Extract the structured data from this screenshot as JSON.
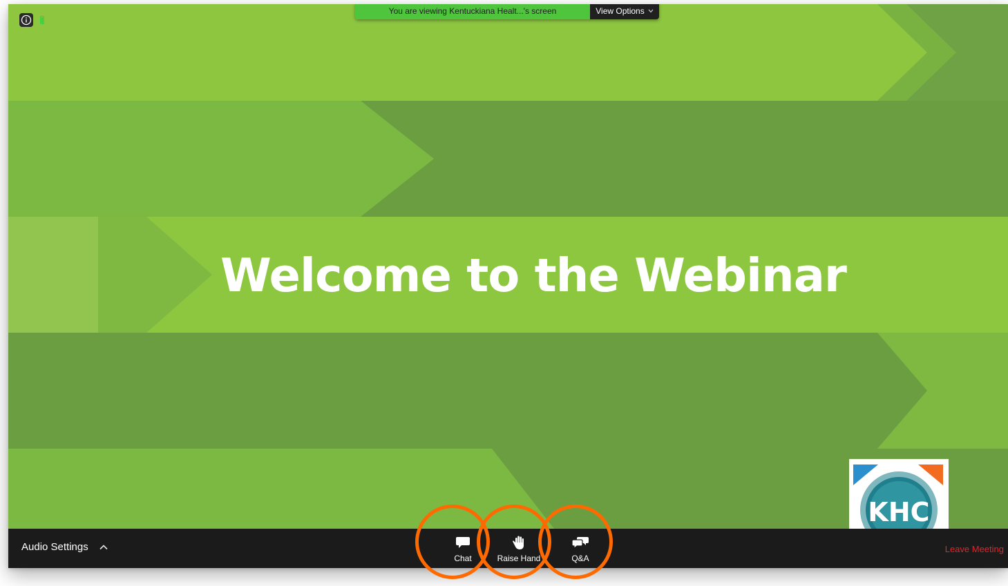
{
  "share_banner": {
    "message": "You are viewing Kentuckiana Healt...'s screen",
    "view_options_label": "View Options"
  },
  "slide": {
    "title": "Welcome to the Webinar",
    "logo_text": "KHC"
  },
  "toolbar": {
    "audio_settings_label": "Audio Settings",
    "chat_label": "Chat",
    "raise_hand_label": "Raise Hand",
    "qa_label": "Q&A",
    "leave_label": "Leave Meeting"
  },
  "colors": {
    "slide_green_light": "#8dc63f",
    "slide_green_mid": "#7cb942",
    "slide_green_dark": "#6b9e41",
    "toolbar_bg": "#1b1b1b",
    "banner_green": "#4fc43d",
    "leave_red": "#e0242b",
    "highlight_orange": "#ff6a00"
  },
  "icons": {
    "info": "info-icon",
    "connection": "battery-icon",
    "view_options": "chevron-down-icon",
    "audio_settings": "chevron-up-icon",
    "chat": "chat-bubble-icon",
    "raise_hand": "hand-icon",
    "qa": "qa-bubbles-icon"
  }
}
